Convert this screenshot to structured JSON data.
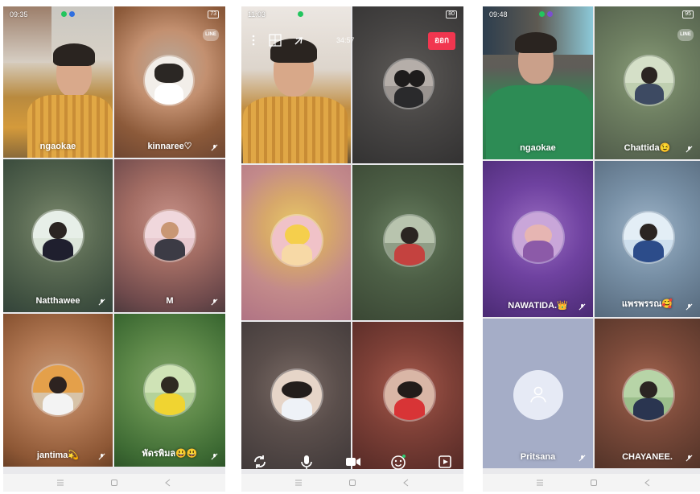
{
  "phones": [
    {
      "status": {
        "time": "09:35",
        "battery": "73"
      },
      "participants": [
        {
          "name": "ngaokae",
          "muted": false,
          "self": true
        },
        {
          "name": "kinnaree♡",
          "muted": true
        },
        {
          "name": "Natthawee",
          "muted": true
        },
        {
          "name": "M",
          "muted": true
        },
        {
          "name": "jantima💫",
          "muted": true
        },
        {
          "name": "พัดรพิมล😃😃",
          "muted": true
        }
      ]
    },
    {
      "status": {
        "time": "11:03",
        "battery": "80"
      },
      "top_bar": {
        "timer": "34:57",
        "leave_label": "ออก"
      },
      "participants": [
        {
          "name": "",
          "muted": false,
          "self": true
        },
        {
          "name": "",
          "muted": false
        },
        {
          "name": "",
          "muted": false
        },
        {
          "name": "",
          "muted": false
        },
        {
          "name": "",
          "muted": false
        },
        {
          "name": "",
          "muted": false
        }
      ],
      "controls": [
        "switch-camera-icon",
        "microphone-icon",
        "video-camera-icon",
        "effects-icon",
        "share-screen-icon"
      ]
    },
    {
      "status": {
        "time": "09:48",
        "battery": "95"
      },
      "participants": [
        {
          "name": "ngaokae",
          "muted": false,
          "self": true
        },
        {
          "name": "Chattida😉",
          "muted": true
        },
        {
          "name": "NAWATIDA.👑",
          "muted": true
        },
        {
          "name": "แพรพรรณ🥰",
          "muted": true
        },
        {
          "name": "Pritsana",
          "muted": true,
          "placeholder": true
        },
        {
          "name": "CHAYANEE.",
          "muted": true
        }
      ]
    }
  ],
  "line_badge": "LINE",
  "colors": {
    "leave": "#f1364f",
    "placeholder_tile": "#a5adc7",
    "navbar": "#f4f4f4"
  }
}
